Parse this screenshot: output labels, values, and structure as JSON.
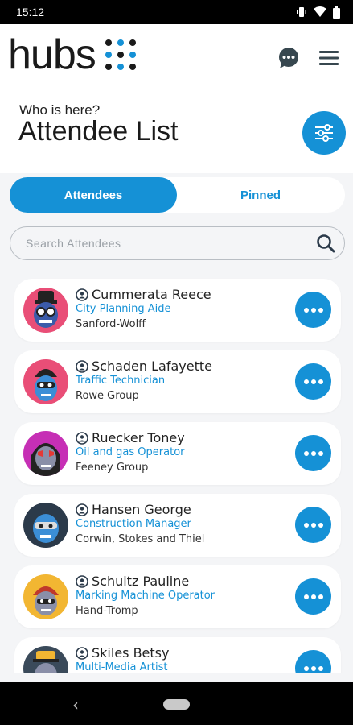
{
  "status_bar": {
    "time": "15:12"
  },
  "brand": {
    "logo_text": "hubs"
  },
  "header": {
    "subtitle": "Who is here?",
    "title": "Attendee List"
  },
  "tabs": [
    {
      "label": "Attendees",
      "active": true
    },
    {
      "label": "Pinned",
      "active": false
    }
  ],
  "search": {
    "placeholder": "Search Attendees"
  },
  "attendees": [
    {
      "name": "Cummerata Reece",
      "role": "City Planning Aide",
      "company": "Sanford-Wolff",
      "avatar_bg": "#e94e77"
    },
    {
      "name": "Schaden Lafayette",
      "role": "Traffic Technician",
      "company": "Rowe Group",
      "avatar_bg": "#e94e77"
    },
    {
      "name": "Ruecker Toney",
      "role": "Oil and gas Operator",
      "company": "Feeney Group",
      "avatar_bg": "#c62fb5"
    },
    {
      "name": "Hansen George",
      "role": "Construction Manager",
      "company": "Corwin, Stokes and Thiel",
      "avatar_bg": "#2b3a4a"
    },
    {
      "name": "Schultz Pauline",
      "role": "Marking Machine Operator",
      "company": "Hand-Tromp",
      "avatar_bg": "#f2b632"
    },
    {
      "name": "Skiles Betsy",
      "role": "Multi-Media Artist",
      "company": "",
      "avatar_bg": "#3a4a5a"
    }
  ],
  "colors": {
    "accent": "#1591d6",
    "background": "#f4f5f7",
    "logo_dot_blue": "#1591d6",
    "logo_dot_dark": "#1a1a1a"
  },
  "icons": {
    "chat": "chat-bubble-icon",
    "menu": "hamburger-menu-icon",
    "filter": "sliders-filter-icon",
    "search": "search-icon",
    "more": "more-horizontal-icon",
    "badge": "attendee-badge-icon"
  }
}
